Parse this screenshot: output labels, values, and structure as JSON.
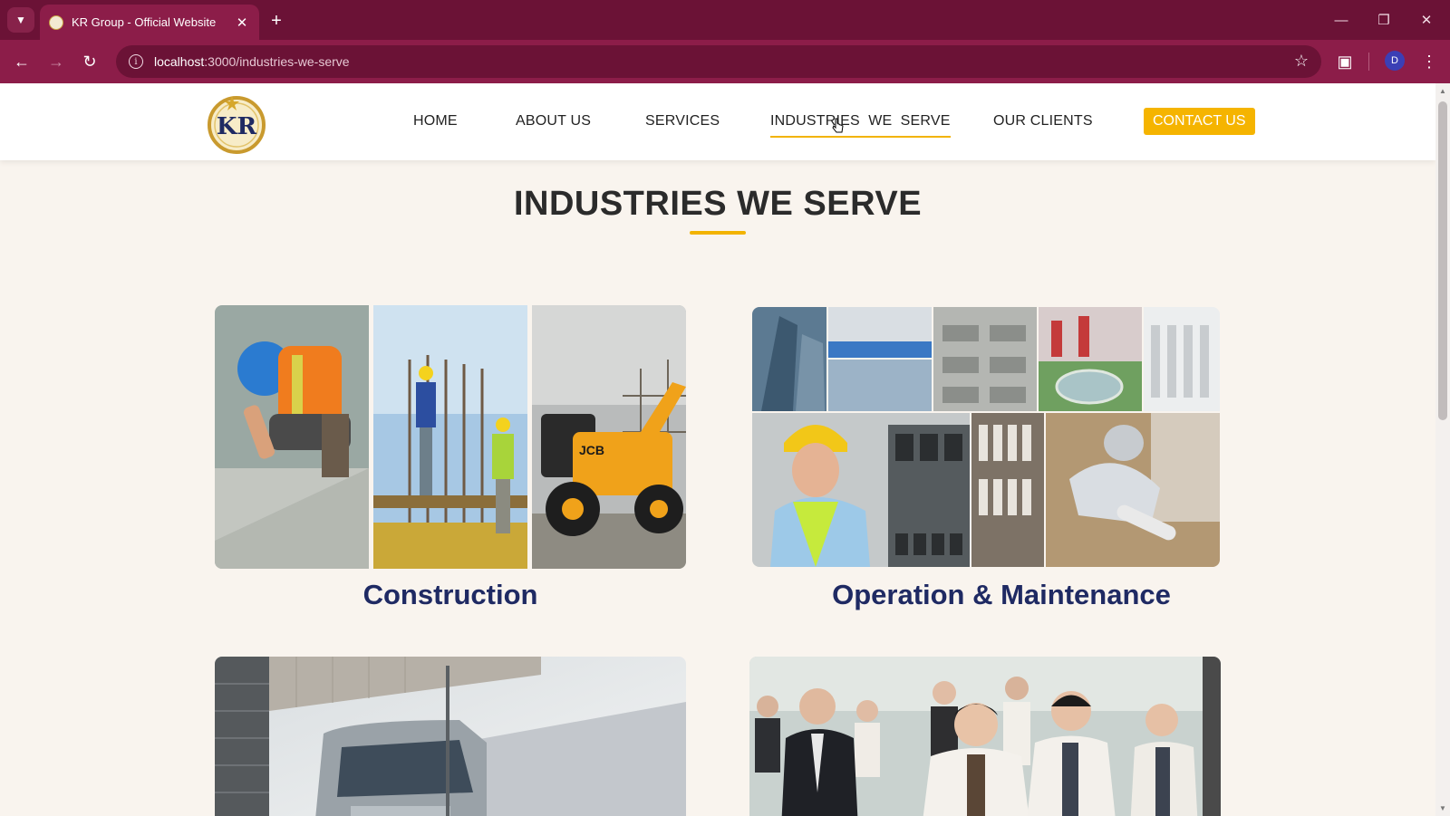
{
  "browser": {
    "tab_title": "KR Group - Official Website",
    "url_host": "localhost",
    "url_path": ":3000/industries-we-serve",
    "profile_initial": "D",
    "icons": [
      "tab-list-icon",
      "close-icon",
      "new-tab-icon",
      "minimize-icon",
      "restore-icon",
      "window-close-icon",
      "back-icon",
      "forward-icon",
      "reload-icon",
      "info-icon",
      "star-icon",
      "extensions-icon",
      "menu-icon"
    ]
  },
  "header": {
    "logo_alt": "KR",
    "nav": [
      {
        "label": "HOME"
      },
      {
        "label": "ABOUT US"
      },
      {
        "label": "SERVICES"
      },
      {
        "label": "INDUSTRIES  WE  SERVE",
        "active": true
      },
      {
        "label": "OUR CLIENTS"
      }
    ],
    "contact_label": "CONTACT US"
  },
  "main": {
    "title": "INDUSTRIES WE SERVE",
    "industries": [
      {
        "label": "Construction"
      },
      {
        "label": "Operation & Maintenance"
      },
      {
        "label": ""
      },
      {
        "label": ""
      }
    ]
  },
  "colors": {
    "chrome": "#8c1d49",
    "accent": "#f2b300",
    "heading_navy": "#1f2a63",
    "background": "#f9f4ee"
  }
}
